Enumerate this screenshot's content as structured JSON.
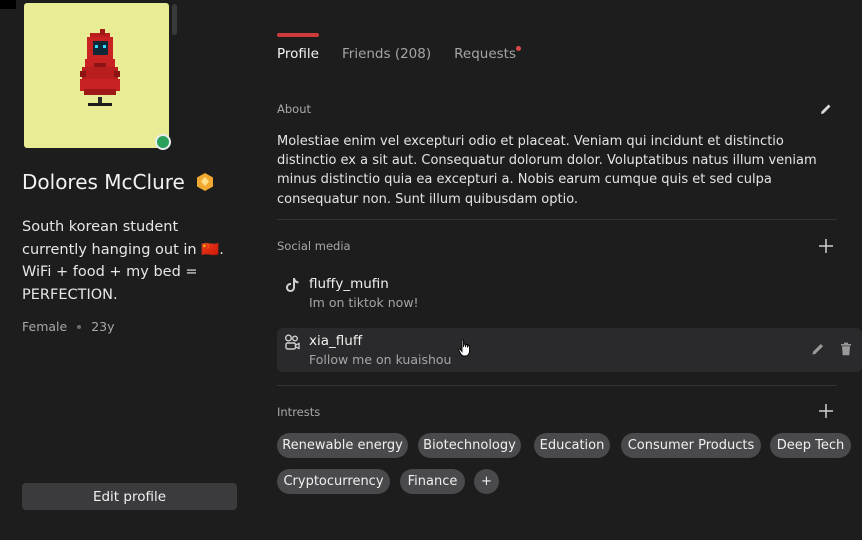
{
  "profile": {
    "name": "Dolores McClure",
    "bio": "South korean student currently hanging out in 🇨🇳. WiFi + food + my bed = PERFECTION.",
    "gender": "Female",
    "age": "23y",
    "status": "online",
    "edit_label": "Edit profile"
  },
  "tabs": [
    {
      "label": "Profile",
      "active": true
    },
    {
      "label": "Friends (208)",
      "active": false
    },
    {
      "label": "Requests",
      "active": false,
      "notification": true
    }
  ],
  "about": {
    "title": "About",
    "text": "Molestiae enim vel excepturi odio et placeat. Veniam qui incidunt et distinctio distinctio ex a sit aut. Consequatur dolorum dolor. Voluptatibus natus illum veniam minus distinctio quia ea excepturi a. Nobis earum cumque quis et sed culpa consequatur non. Sunt illum quibusdam optio."
  },
  "social": {
    "title": "Social media",
    "items": [
      {
        "icon": "tiktok-icon",
        "username": "fluffy_mufin",
        "description": "Im on tiktok now!"
      },
      {
        "icon": "kuaishou-icon",
        "username": "xia_fluff",
        "description": "Follow me on kuaishou"
      }
    ]
  },
  "interests": {
    "title": "Intrests",
    "items": [
      "Renewable energy",
      "Biotechnology",
      "Education",
      "Consumer Products",
      "Deep Tech",
      "Cryptocurrency",
      "Finance"
    ],
    "add_label": "+"
  },
  "colors": {
    "background": "#1d1d1e",
    "accent": "#cf3a3a",
    "online": "#2aa05a",
    "avatar_bg": "#e8ec95",
    "chip": "#4a4a4c",
    "badge": "#f0a830"
  }
}
